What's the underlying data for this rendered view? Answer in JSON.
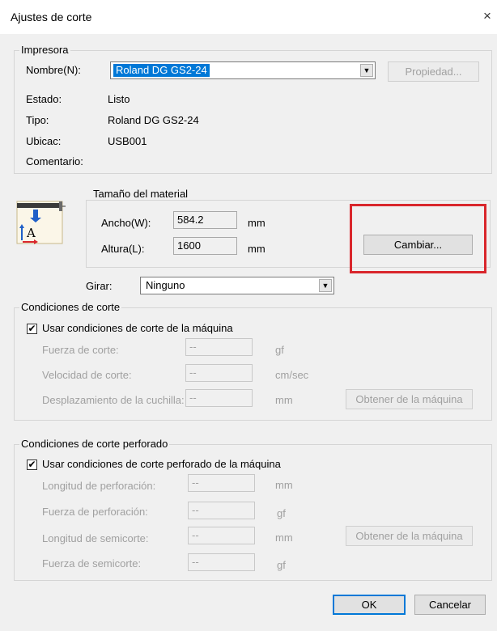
{
  "window": {
    "title": "Ajustes de corte",
    "close_glyph": "×"
  },
  "printer": {
    "group_label": "Impresora",
    "name_label": "Nombre(N):",
    "name_value": "Roland DG GS2-24",
    "property_button": "Propiedad...",
    "status_label": "Estado:",
    "status_value": "Listo",
    "type_label": "Tipo:",
    "type_value": "Roland DG GS2-24",
    "location_label": "Ubicac:",
    "location_value": "USB001",
    "comment_label": "Comentario:"
  },
  "material": {
    "group_label": "Tamaño del material",
    "width_label": "Ancho(W):",
    "width_value": "584.2",
    "width_unit": "mm",
    "height_label": "Altura(L):",
    "height_value": "1600",
    "height_unit": "mm",
    "change_button": "Cambiar...",
    "rotate_label": "Girar:",
    "rotate_value": "Ninguno"
  },
  "cut_conditions": {
    "group_label": "Condiciones de corte",
    "use_machine_label": "Usar condiciones de corte de la máquina",
    "use_machine_checked": true,
    "force_label": "Fuerza de corte:",
    "force_value": "--",
    "force_unit": "gf",
    "speed_label": "Velocidad de corte:",
    "speed_value": "--",
    "speed_unit": "cm/sec",
    "offset_label": "Desplazamiento de la cuchilla:",
    "offset_value": "--",
    "offset_unit": "mm",
    "get_button": "Obtener de la máquina"
  },
  "perf_conditions": {
    "group_label": "Condiciones de corte perforado",
    "use_machine_label": "Usar condiciones de corte perforado de la máquina",
    "use_machine_checked": true,
    "perf_length_label": "Longitud de perforación:",
    "perf_length_value": "--",
    "perf_length_unit": "mm",
    "perf_force_label": "Fuerza de perforación:",
    "perf_force_value": "--",
    "perf_force_unit": "gf",
    "half_length_label": "Longitud de semicorte:",
    "half_length_value": "--",
    "half_length_unit": "mm",
    "half_force_label": "Fuerza de semicorte:",
    "half_force_value": "--",
    "half_force_unit": "gf",
    "get_button": "Obtener de la máquina"
  },
  "footer": {
    "ok_button": "OK",
    "cancel_button": "Cancelar"
  },
  "check_glyph": "✔",
  "colors": {
    "highlight": "#d9262c",
    "selection": "#0078d7",
    "dialog_bg": "#f0f0f0"
  }
}
